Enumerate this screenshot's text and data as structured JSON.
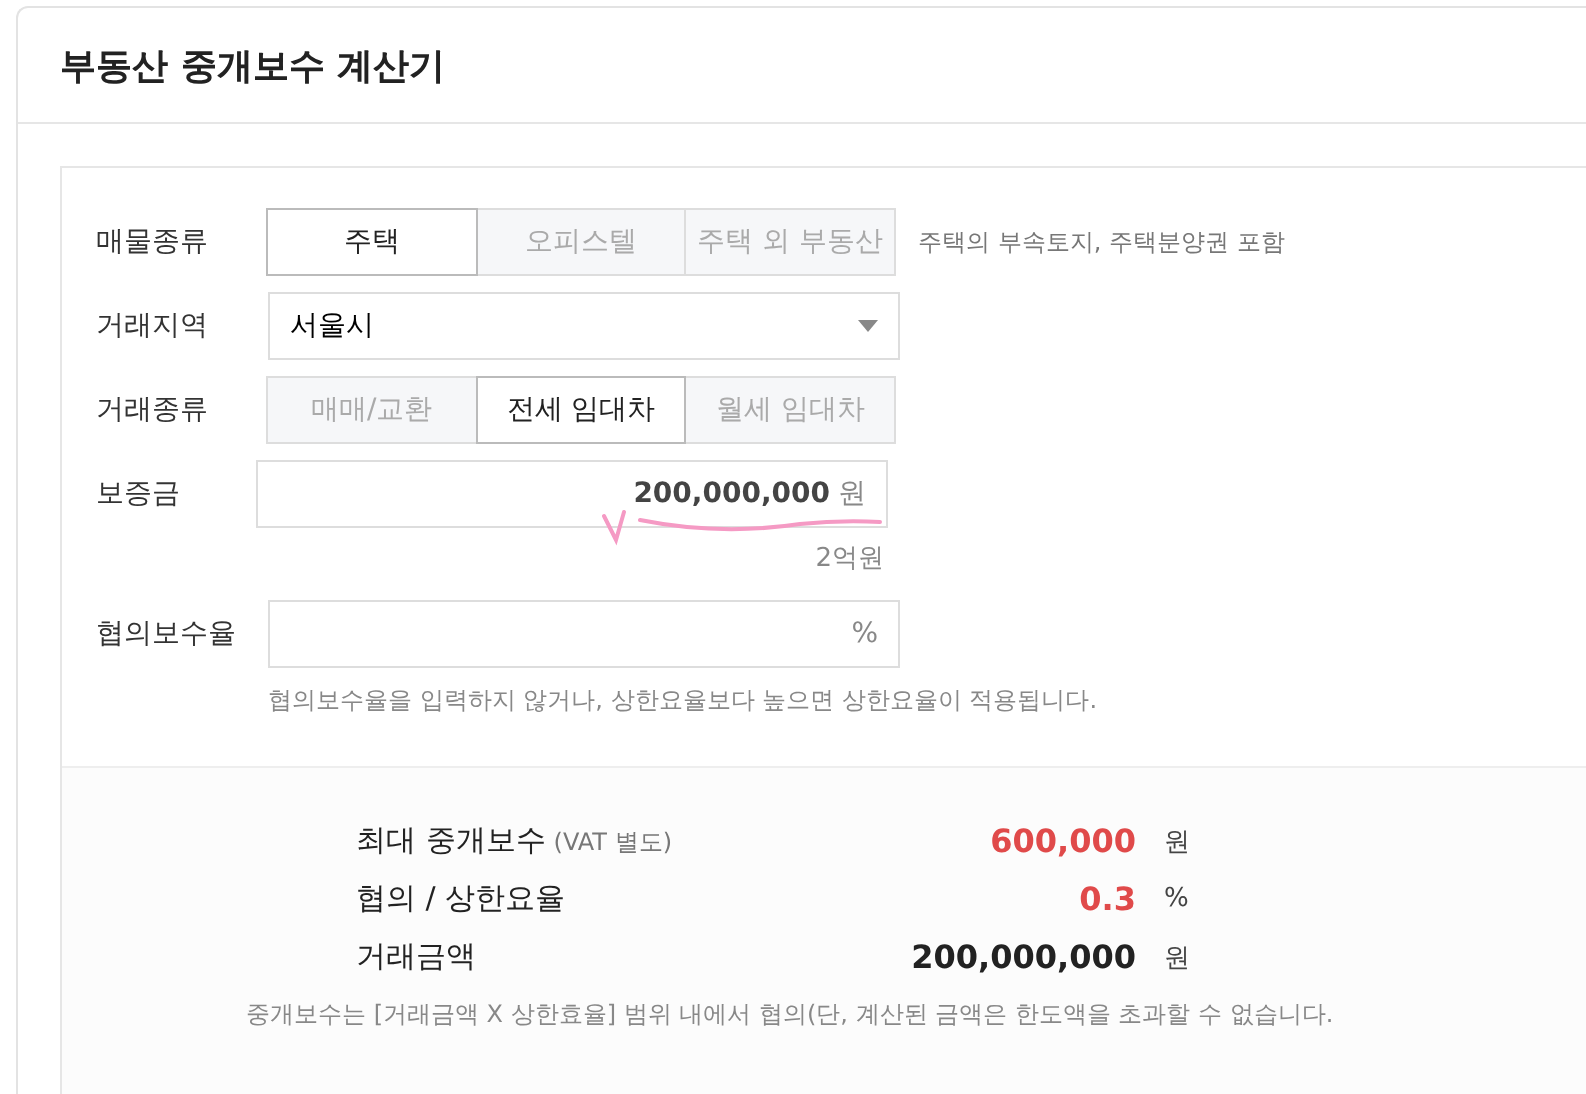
{
  "title": "부동산 중개보수 계산기",
  "property_type": {
    "label": "매물종류",
    "options": [
      {
        "label": "주택",
        "selected": true
      },
      {
        "label": "오피스텔",
        "selected": false
      },
      {
        "label": "주택 외 부동산",
        "selected": false
      }
    ],
    "note": "주택의 부속토지, 주택분양권 포함"
  },
  "region": {
    "label": "거래지역",
    "value": "서울시"
  },
  "deal_type": {
    "label": "거래종류",
    "options": [
      {
        "label": "매매/교환",
        "selected": false
      },
      {
        "label": "전세 임대차",
        "selected": true
      },
      {
        "label": "월세 임대차",
        "selected": false
      }
    ]
  },
  "deposit": {
    "label": "보증금",
    "value": "200,000,000",
    "unit": "원",
    "reading": "2억원"
  },
  "rate": {
    "label": "협의보수율",
    "unit": "%",
    "hint": "협의보수율을 입력하지 않거나, 상한요율보다 높으면 상한요율이 적용됩니다."
  },
  "results": [
    {
      "label": "최대 중개보수",
      "sublabel": "(VAT 별도)",
      "value": "600,000",
      "unit": "원",
      "highlight": true
    },
    {
      "label": "협의 / 상한요율",
      "value": "0.3",
      "unit": "%",
      "highlight": true
    },
    {
      "label": "거래금액",
      "value": "200,000,000",
      "unit": "원",
      "highlight": false
    }
  ],
  "footnote": "중개보수는 [거래금액 X 상한효율] 범위 내에서 협의(단, 계산된 금액은 한도액을 초과할 수 없습니다."
}
